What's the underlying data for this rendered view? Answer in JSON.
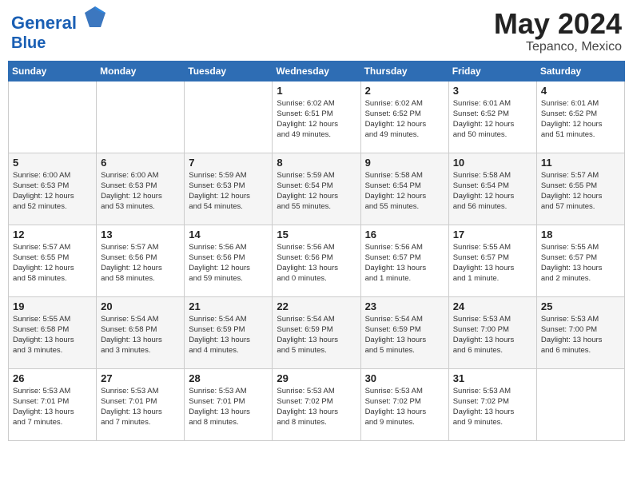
{
  "header": {
    "logo_line1": "General",
    "logo_line2": "Blue",
    "month_year": "May 2024",
    "location": "Tepanco, Mexico"
  },
  "weekdays": [
    "Sunday",
    "Monday",
    "Tuesday",
    "Wednesday",
    "Thursday",
    "Friday",
    "Saturday"
  ],
  "weeks": [
    [
      {
        "day": "",
        "info": ""
      },
      {
        "day": "",
        "info": ""
      },
      {
        "day": "",
        "info": ""
      },
      {
        "day": "1",
        "info": "Sunrise: 6:02 AM\nSunset: 6:51 PM\nDaylight: 12 hours\nand 49 minutes."
      },
      {
        "day": "2",
        "info": "Sunrise: 6:02 AM\nSunset: 6:52 PM\nDaylight: 12 hours\nand 49 minutes."
      },
      {
        "day": "3",
        "info": "Sunrise: 6:01 AM\nSunset: 6:52 PM\nDaylight: 12 hours\nand 50 minutes."
      },
      {
        "day": "4",
        "info": "Sunrise: 6:01 AM\nSunset: 6:52 PM\nDaylight: 12 hours\nand 51 minutes."
      }
    ],
    [
      {
        "day": "5",
        "info": "Sunrise: 6:00 AM\nSunset: 6:53 PM\nDaylight: 12 hours\nand 52 minutes."
      },
      {
        "day": "6",
        "info": "Sunrise: 6:00 AM\nSunset: 6:53 PM\nDaylight: 12 hours\nand 53 minutes."
      },
      {
        "day": "7",
        "info": "Sunrise: 5:59 AM\nSunset: 6:53 PM\nDaylight: 12 hours\nand 54 minutes."
      },
      {
        "day": "8",
        "info": "Sunrise: 5:59 AM\nSunset: 6:54 PM\nDaylight: 12 hours\nand 55 minutes."
      },
      {
        "day": "9",
        "info": "Sunrise: 5:58 AM\nSunset: 6:54 PM\nDaylight: 12 hours\nand 55 minutes."
      },
      {
        "day": "10",
        "info": "Sunrise: 5:58 AM\nSunset: 6:54 PM\nDaylight: 12 hours\nand 56 minutes."
      },
      {
        "day": "11",
        "info": "Sunrise: 5:57 AM\nSunset: 6:55 PM\nDaylight: 12 hours\nand 57 minutes."
      }
    ],
    [
      {
        "day": "12",
        "info": "Sunrise: 5:57 AM\nSunset: 6:55 PM\nDaylight: 12 hours\nand 58 minutes."
      },
      {
        "day": "13",
        "info": "Sunrise: 5:57 AM\nSunset: 6:56 PM\nDaylight: 12 hours\nand 58 minutes."
      },
      {
        "day": "14",
        "info": "Sunrise: 5:56 AM\nSunset: 6:56 PM\nDaylight: 12 hours\nand 59 minutes."
      },
      {
        "day": "15",
        "info": "Sunrise: 5:56 AM\nSunset: 6:56 PM\nDaylight: 13 hours\nand 0 minutes."
      },
      {
        "day": "16",
        "info": "Sunrise: 5:56 AM\nSunset: 6:57 PM\nDaylight: 13 hours\nand 1 minute."
      },
      {
        "day": "17",
        "info": "Sunrise: 5:55 AM\nSunset: 6:57 PM\nDaylight: 13 hours\nand 1 minute."
      },
      {
        "day": "18",
        "info": "Sunrise: 5:55 AM\nSunset: 6:57 PM\nDaylight: 13 hours\nand 2 minutes."
      }
    ],
    [
      {
        "day": "19",
        "info": "Sunrise: 5:55 AM\nSunset: 6:58 PM\nDaylight: 13 hours\nand 3 minutes."
      },
      {
        "day": "20",
        "info": "Sunrise: 5:54 AM\nSunset: 6:58 PM\nDaylight: 13 hours\nand 3 minutes."
      },
      {
        "day": "21",
        "info": "Sunrise: 5:54 AM\nSunset: 6:59 PM\nDaylight: 13 hours\nand 4 minutes."
      },
      {
        "day": "22",
        "info": "Sunrise: 5:54 AM\nSunset: 6:59 PM\nDaylight: 13 hours\nand 5 minutes."
      },
      {
        "day": "23",
        "info": "Sunrise: 5:54 AM\nSunset: 6:59 PM\nDaylight: 13 hours\nand 5 minutes."
      },
      {
        "day": "24",
        "info": "Sunrise: 5:53 AM\nSunset: 7:00 PM\nDaylight: 13 hours\nand 6 minutes."
      },
      {
        "day": "25",
        "info": "Sunrise: 5:53 AM\nSunset: 7:00 PM\nDaylight: 13 hours\nand 6 minutes."
      }
    ],
    [
      {
        "day": "26",
        "info": "Sunrise: 5:53 AM\nSunset: 7:01 PM\nDaylight: 13 hours\nand 7 minutes."
      },
      {
        "day": "27",
        "info": "Sunrise: 5:53 AM\nSunset: 7:01 PM\nDaylight: 13 hours\nand 7 minutes."
      },
      {
        "day": "28",
        "info": "Sunrise: 5:53 AM\nSunset: 7:01 PM\nDaylight: 13 hours\nand 8 minutes."
      },
      {
        "day": "29",
        "info": "Sunrise: 5:53 AM\nSunset: 7:02 PM\nDaylight: 13 hours\nand 8 minutes."
      },
      {
        "day": "30",
        "info": "Sunrise: 5:53 AM\nSunset: 7:02 PM\nDaylight: 13 hours\nand 9 minutes."
      },
      {
        "day": "31",
        "info": "Sunrise: 5:53 AM\nSunset: 7:02 PM\nDaylight: 13 hours\nand 9 minutes."
      },
      {
        "day": "",
        "info": ""
      }
    ]
  ]
}
